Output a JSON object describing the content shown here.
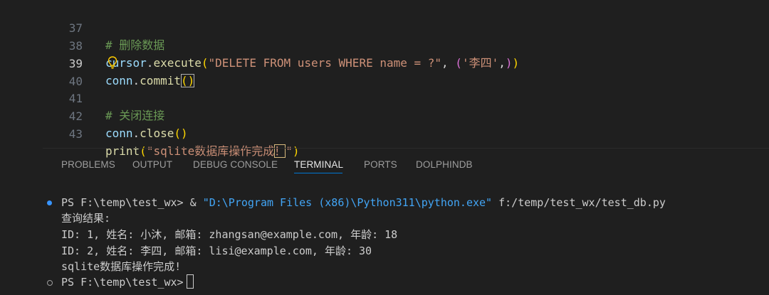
{
  "editor": {
    "lines": [
      {
        "num": "37",
        "comment": "# 删除数据"
      },
      {
        "num": "38",
        "obj": "cursor",
        "dot": ".",
        "method": "execute",
        "open": "(",
        "sql": "\"DELETE FROM users WHERE name = ?\"",
        "comma": ", ",
        "tuple_open": "(",
        "arg": "'李四'",
        "tuple_comma": ",",
        "tuple_close": ")",
        "close": ")"
      },
      {
        "num": "39",
        "obj": "conn",
        "dot": ".",
        "method": "commit",
        "parens": "()"
      },
      {
        "num": "40"
      },
      {
        "num": "41",
        "comment": "# 关闭连接"
      },
      {
        "num": "42",
        "obj": "conn",
        "dot": ".",
        "method": "close",
        "parens": "()"
      },
      {
        "num": "43",
        "fn": "print",
        "open": "(",
        "str_a": "\"sqlite数据库操作完成",
        "str_b": "！",
        "str_c": "\"",
        "close": ")"
      }
    ],
    "lightbulb_icon": "lightbulb-icon"
  },
  "panel": {
    "tabs": [
      "PROBLEMS",
      "OUTPUT",
      "DEBUG CONSOLE",
      "TERMINAL",
      "PORTS",
      "DOLPHINDB"
    ],
    "active_tab": "TERMINAL"
  },
  "terminal": {
    "prompt1": "PS F:\\temp\\test_wx> & ",
    "python_path": "\"D:\\Program Files (x86)\\Python311\\python.exe\"",
    "script_path": " f:/temp/test_wx/test_db.py",
    "out1": "查询结果:",
    "out2": "ID: 1, 姓名: 小沐, 邮箱: zhangsan@example.com, 年龄: 18",
    "out3": "ID: 2, 姓名: 李四, 邮箱: lisi@example.com, 年龄: 30",
    "out4": "sqlite数据库操作完成!",
    "prompt2": "PS F:\\temp\\test_wx>"
  },
  "colors": {
    "background": "#1f1f1f",
    "accent": "#0078d4",
    "comment": "#6a9955",
    "string": "#ce9178",
    "terminal_string": "#42a5f5"
  }
}
